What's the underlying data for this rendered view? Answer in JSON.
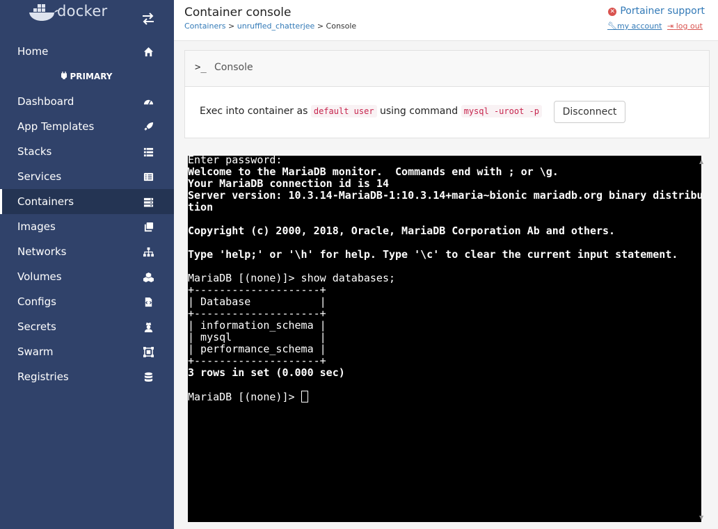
{
  "sidebar": {
    "brand": "docker",
    "endpoint": "PRIMARY",
    "home": "Home",
    "items": [
      {
        "label": "Dashboard",
        "icon": "dashboard-icon"
      },
      {
        "label": "App Templates",
        "icon": "rocket-icon"
      },
      {
        "label": "Stacks",
        "icon": "list-icon"
      },
      {
        "label": "Services",
        "icon": "services-icon"
      },
      {
        "label": "Containers",
        "icon": "server-icon",
        "active": true
      },
      {
        "label": "Images",
        "icon": "clone-icon"
      },
      {
        "label": "Networks",
        "icon": "sitemap-icon"
      },
      {
        "label": "Volumes",
        "icon": "cubes-icon"
      },
      {
        "label": "Configs",
        "icon": "file-code-icon"
      },
      {
        "label": "Secrets",
        "icon": "user-secret-icon"
      },
      {
        "label": "Swarm",
        "icon": "object-group-icon"
      },
      {
        "label": "Registries",
        "icon": "database-icon"
      }
    ]
  },
  "header": {
    "title": "Container console",
    "breadcrumb": {
      "containers": "Containers",
      "sep": ">",
      "container": "unruffled_chatterjee",
      "current": "Console"
    },
    "support": "Portainer support",
    "my_account": "my account",
    "log_out": "log out"
  },
  "console": {
    "title": "Console",
    "exec_prefix": "Exec into container as",
    "user": "default user",
    "using_command": "using command",
    "command": "mysql -uroot -p",
    "disconnect": "Disconnect"
  },
  "terminal": {
    "lines": [
      {
        "text": "Enter password:",
        "bold": false
      },
      {
        "text": "Welcome to the MariaDB monitor.  Commands end with ; or \\g.",
        "bold": true
      },
      {
        "text": "Your MariaDB connection id is 14",
        "bold": true
      },
      {
        "text": "Server version: 10.3.14-MariaDB-1:10.3.14+maria~bionic mariadb.org binary distribu",
        "bold": true
      },
      {
        "text": "tion",
        "bold": true
      },
      {
        "text": "",
        "bold": false
      },
      {
        "text": "Copyright (c) 2000, 2018, Oracle, MariaDB Corporation Ab and others.",
        "bold": true
      },
      {
        "text": "",
        "bold": false
      },
      {
        "text": "Type 'help;' or '\\h' for help. Type '\\c' to clear the current input statement.",
        "bold": true
      },
      {
        "text": "",
        "bold": false
      },
      {
        "text": "MariaDB [(none)]> show databases;",
        "bold": false
      },
      {
        "text": "+--------------------+",
        "bold": false
      },
      {
        "text": "| Database           |",
        "bold": false
      },
      {
        "text": "+--------------------+",
        "bold": false
      },
      {
        "text": "| information_schema |",
        "bold": false
      },
      {
        "text": "| mysql              |",
        "bold": false
      },
      {
        "text": "| performance_schema |",
        "bold": false
      },
      {
        "text": "+--------------------+",
        "bold": false
      },
      {
        "text": "3 rows in set (0.000 sec)",
        "bold": true
      },
      {
        "text": "",
        "bold": false
      },
      {
        "text": "MariaDB [(none)]> ",
        "bold": false,
        "cursor": true
      }
    ]
  },
  "colors": {
    "sidebar_bg": "#30426a",
    "active_bg": "#243453",
    "link": "#337ab7",
    "danger": "#d9534f",
    "terminal_bg": "#000000"
  }
}
